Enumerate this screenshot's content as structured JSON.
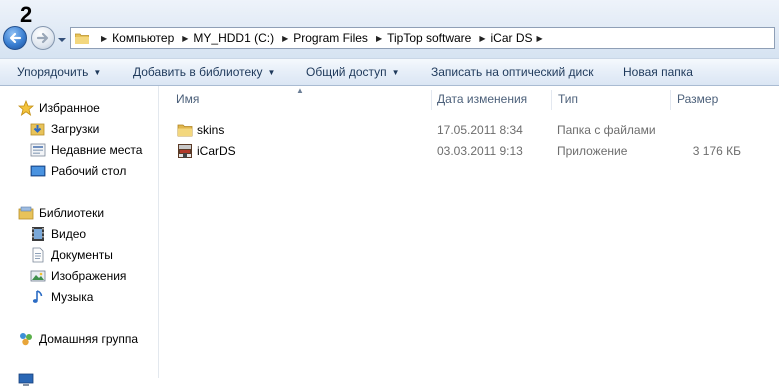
{
  "annotation_number": "2",
  "breadcrumb": {
    "items": [
      {
        "label": "Компьютер"
      },
      {
        "label": "MY_HDD1 (C:)"
      },
      {
        "label": "Program Files"
      },
      {
        "label": "TipTop software"
      },
      {
        "label": "iCar DS"
      }
    ]
  },
  "toolbar": {
    "organize": "Упорядочить",
    "add_to_library": "Добавить в библиотеку",
    "share": "Общий доступ",
    "burn": "Записать на оптический диск",
    "new_folder": "Новая папка"
  },
  "nav": {
    "favorites": {
      "label": "Избранное",
      "items": [
        {
          "label": "Загрузки",
          "icon": "downloads-icon"
        },
        {
          "label": "Недавние места",
          "icon": "recent-places-icon"
        },
        {
          "label": "Рабочий стол",
          "icon": "desktop-icon"
        }
      ]
    },
    "libraries": {
      "label": "Библиотеки",
      "items": [
        {
          "label": "Видео",
          "icon": "video-icon"
        },
        {
          "label": "Документы",
          "icon": "documents-icon"
        },
        {
          "label": "Изображения",
          "icon": "pictures-icon"
        },
        {
          "label": "Музыка",
          "icon": "music-icon"
        }
      ]
    },
    "homegroup": {
      "label": "Домашняя группа"
    }
  },
  "file_list": {
    "columns": {
      "name": "Имя",
      "date": "Дата изменения",
      "type": "Тип",
      "size": "Размер"
    },
    "rows": [
      {
        "name": "skins",
        "date": "17.05.2011 8:34",
        "type": "Папка с файлами",
        "size": "",
        "icon": "folder-icon"
      },
      {
        "name": "iCarDS",
        "date": "03.03.2011 9:13",
        "type": "Приложение",
        "size": "3 176 КБ",
        "icon": "application-icon"
      }
    ]
  },
  "colors": {
    "accent": "#1e395b",
    "folder": "#e8c35a",
    "back_button": "#3a7fd2"
  }
}
